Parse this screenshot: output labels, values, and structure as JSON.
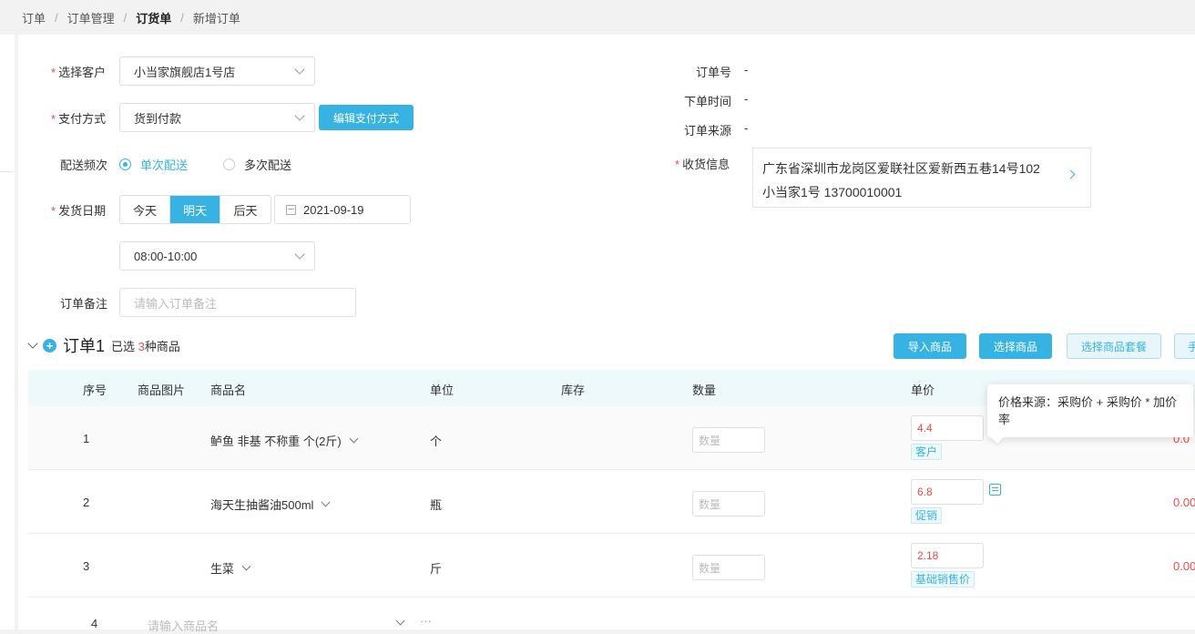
{
  "breadcrumb": [
    "订单",
    "订单管理",
    "订货单",
    "新增订单"
  ],
  "form": {
    "customer_label": "选择客户",
    "customer_value": "小当家旗舰店1号店",
    "payment_label": "支付方式",
    "payment_value": "货到付款",
    "edit_payment_button": "编辑支付方式",
    "frequency_label": "配送频次",
    "frequency_single": "单次配送",
    "frequency_multi": "多次配送",
    "ship_date_label": "发货日期",
    "day_today": "今天",
    "day_tomorrow": "明天",
    "day_after": "后天",
    "date_value": "2021-09-19",
    "time_value": "08:00-10:00",
    "remark_label": "订单备注",
    "remark_placeholder": "请输入订单备注"
  },
  "info": {
    "order_no_label": "订单号",
    "order_no_value": "-",
    "order_time_label": "下单时间",
    "order_time_value": "-",
    "order_source_label": "订单来源",
    "order_source_value": "-",
    "receive_label": "收货信息",
    "address_line1": "广东省深圳市龙岗区爱联社区爱新西五巷14号102",
    "address_line2": "小当家1号 13700010001"
  },
  "order": {
    "title": "订单1",
    "selected_prefix": "已选",
    "selected_count": "3",
    "selected_suffix": "种商品",
    "buttons": {
      "import": "导入商品",
      "select": "选择商品",
      "select_combo": "选择商品套餐",
      "manual_partial": "手"
    }
  },
  "table": {
    "headers": {
      "index": "序号",
      "image": "商品图片",
      "name": "商品名",
      "unit": "单位",
      "stock": "库存",
      "qty": "数量",
      "price": "单价"
    },
    "qty_placeholder": "数量",
    "rows": [
      {
        "index": "1",
        "name": "鲈鱼 非基 不称重 个(2斤)",
        "unit": "个",
        "price": "4.4",
        "tag": "客户",
        "total": "0.0"
      },
      {
        "index": "2",
        "name": "海天生抽酱油500ml",
        "unit": "瓶",
        "price": "6.8",
        "tag": "促销",
        "total": "0.00"
      },
      {
        "index": "3",
        "name": "生菜",
        "unit": "斤",
        "price": "2.18",
        "tag": "基础销售价",
        "total": "0.00"
      }
    ],
    "new_row_index": "4",
    "new_row_placeholder": "请输入商品名",
    "new_row_more": "···"
  },
  "tooltip": "价格来源：采购价 + 采购价 * 加价率",
  "colors": {
    "accent": "#36b2e3",
    "danger": "#e94b4b"
  }
}
